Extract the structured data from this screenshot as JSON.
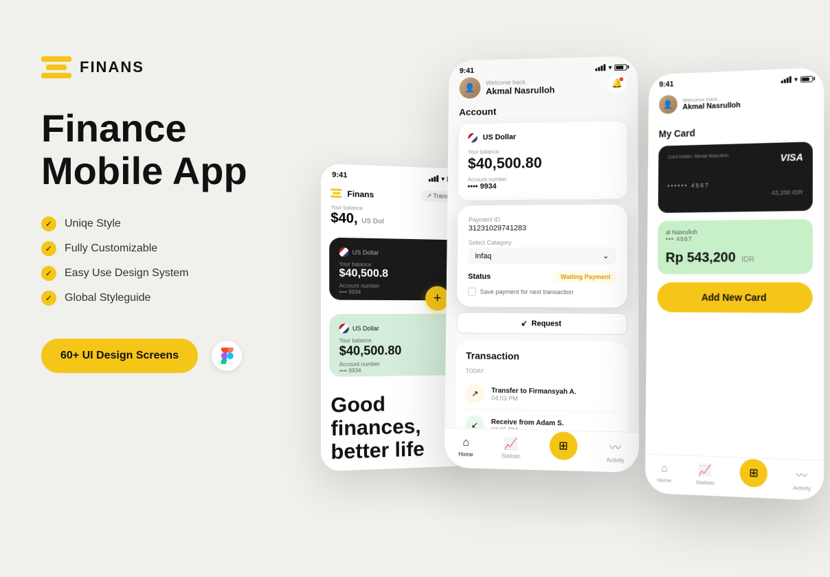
{
  "logo": {
    "text": "FINANS"
  },
  "headline": {
    "line1": "Finance",
    "line2": "Mobile App"
  },
  "features": [
    "Uniqe Style",
    "Fully Customizable",
    "Easy Use Design System",
    "Global Styleguide"
  ],
  "cta": {
    "screens_btn": "60+ UI Design Screens"
  },
  "phone_main": {
    "time": "9:41",
    "welcome_label": "Welcome back,",
    "user_name": "Akmal Nasrulloh",
    "account_title": "Account",
    "currency": "US Dollar",
    "balance_label": "Your balance",
    "balance": "$40,500.80",
    "account_number_label": "Account number",
    "account_number": "•••• 9934",
    "payment_id_label": "Payment ID",
    "payment_id": "31231029741283",
    "category_label": "Select Catagory",
    "category_value": "Infaq",
    "status_label": "Status",
    "status_value": "Waiting Payment",
    "save_text": "Save payment for next transaction",
    "request_btn": "Request",
    "transaction_title": "Transaction",
    "today_label": "TODAY",
    "transactions": [
      {
        "name": "Transfer to Firmansyah A.",
        "time": "04:03 PM",
        "type": "send"
      },
      {
        "name": "Receive from Adam S.",
        "time": "02:15 PM",
        "type": "receive"
      }
    ]
  },
  "phone_bg": {
    "time": "9:41",
    "brand": "Finans",
    "transfer_label": "Transfer",
    "balance_label": "Your balance",
    "balance": "$40,",
    "currency": "US Dol",
    "card1": {
      "currency": "US Dollar",
      "balance_label": "Your balance",
      "balance": "$40,500.8",
      "account_label": "Account number",
      "account": "•••• 9934"
    },
    "card2": {
      "currency": "US Dollar",
      "balance_label": "Your balance",
      "balance": "$40,500.80",
      "account_label": "Account number",
      "account": "•••• 9934"
    },
    "good_finances": "Good\nfinances,\nbetter life"
  },
  "phone_right": {
    "time": "9:41",
    "welcome_label": "Welcome back,",
    "user_name": "Akmal Nasrulloh",
    "my_card_title": "My Card",
    "visa_label": "VISA",
    "card_holder_label": "Card holder: Akmal Nasrulloh",
    "card_dots": "•••••• 4567",
    "idr_amount": "43,200 IDR",
    "rp_amount": "Rp 543,200",
    "idr_label": "IDR",
    "card2_user": "al Nasrulloh",
    "card2_dots": "••• 4567",
    "add_card_btn": "Add New Card"
  },
  "bottom_nav": {
    "home_label": "Home",
    "statistic_label": "Statistic",
    "activity_label": "Activity"
  },
  "colors": {
    "yellow": "#f5c518",
    "dark": "#1a1a1a",
    "green_card": "#c8f0c8"
  }
}
